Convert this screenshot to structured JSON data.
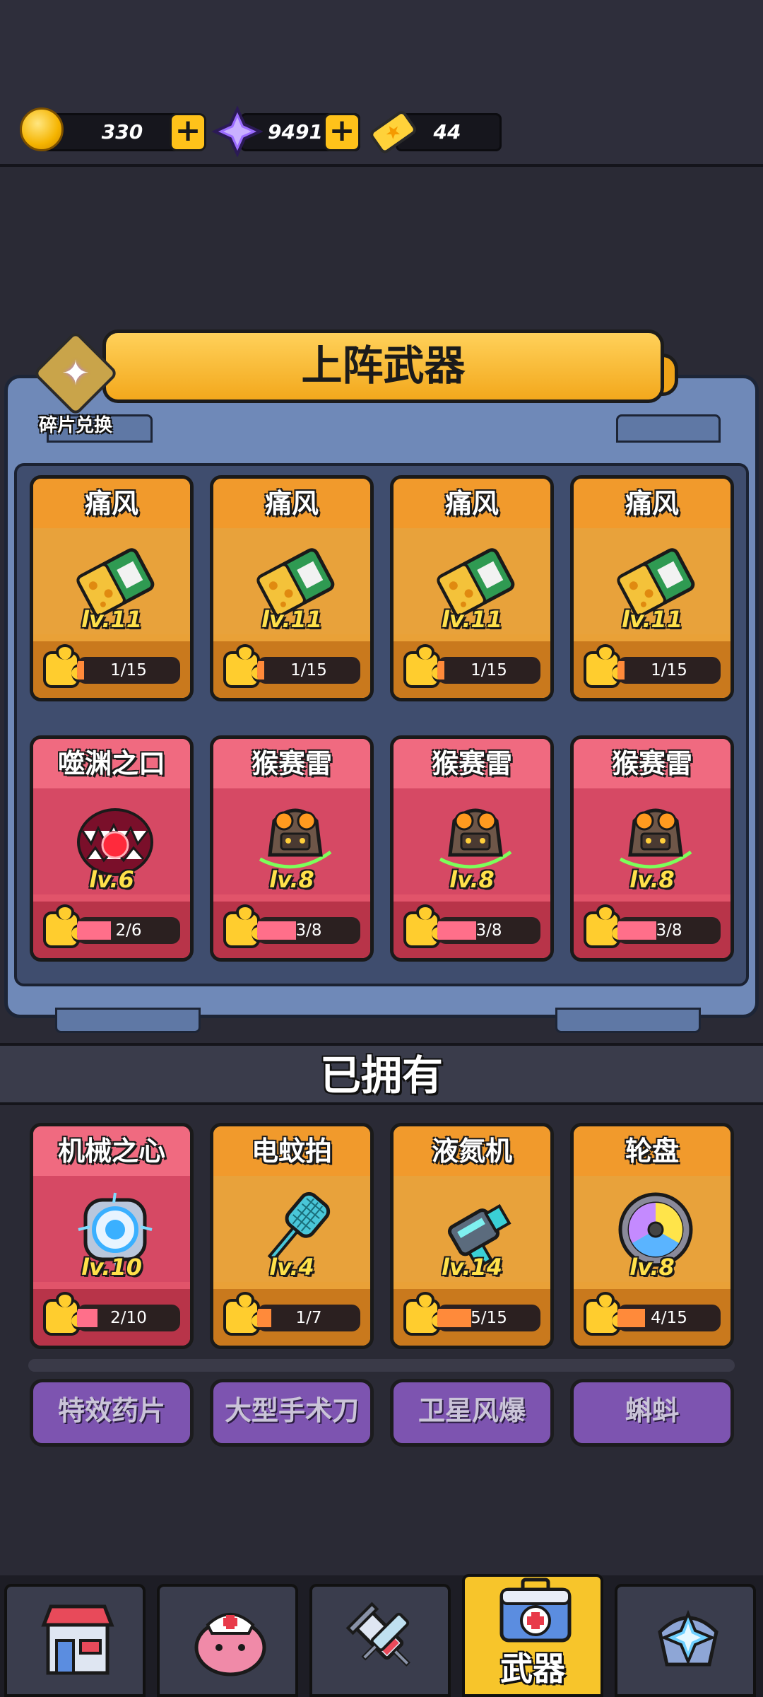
{
  "currencies": {
    "coins": "330",
    "gems": "9491",
    "tickets": "44"
  },
  "deck": {
    "title": "上阵武器",
    "shard_exchange_label": "碎片兑换",
    "cards": [
      {
        "name": "痛风",
        "level": "lv.11",
        "progress": "1/15",
        "fill": 0.0667,
        "theme": "orange",
        "icon": "gout-card-icon"
      },
      {
        "name": "痛风",
        "level": "lv.11",
        "progress": "1/15",
        "fill": 0.0667,
        "theme": "orange",
        "icon": "gout-card-icon"
      },
      {
        "name": "痛风",
        "level": "lv.11",
        "progress": "1/15",
        "fill": 0.0667,
        "theme": "orange",
        "icon": "gout-card-icon"
      },
      {
        "name": "痛风",
        "level": "lv.11",
        "progress": "1/15",
        "fill": 0.0667,
        "theme": "orange",
        "icon": "gout-card-icon"
      },
      {
        "name": "噬渊之口",
        "level": "lv.6",
        "progress": "2/6",
        "fill": 0.333,
        "theme": "red",
        "icon": "abyss-mouth-icon"
      },
      {
        "name": "猴赛雷",
        "level": "lv.8",
        "progress": "3/8",
        "fill": 0.375,
        "theme": "red",
        "icon": "monkey-thunder-icon"
      },
      {
        "name": "猴赛雷",
        "level": "lv.8",
        "progress": "3/8",
        "fill": 0.375,
        "theme": "red",
        "icon": "monkey-thunder-icon"
      },
      {
        "name": "猴赛雷",
        "level": "lv.8",
        "progress": "3/8",
        "fill": 0.375,
        "theme": "red",
        "icon": "monkey-thunder-icon"
      }
    ]
  },
  "owned": {
    "title": "已拥有",
    "cards": [
      {
        "name": "机械之心",
        "level": "lv.10",
        "progress": "2/10",
        "fill": 0.2,
        "theme": "red",
        "icon": "mech-heart-icon"
      },
      {
        "name": "电蚊拍",
        "level": "lv.4",
        "progress": "1/7",
        "fill": 0.143,
        "theme": "orange",
        "icon": "fly-swatter-icon"
      },
      {
        "name": "液氮机",
        "level": "lv.14",
        "progress": "5/15",
        "fill": 0.333,
        "theme": "orange",
        "icon": "liquid-nitrogen-icon"
      },
      {
        "name": "轮盘",
        "level": "lv.8",
        "progress": "4/15",
        "fill": 0.267,
        "theme": "orange",
        "icon": "roulette-icon"
      }
    ],
    "locked": [
      "特效药片",
      "大型手术刀",
      "卫星风爆",
      "蝌蚪"
    ]
  },
  "nav": {
    "tabs": [
      {
        "name": "shop",
        "icon": "shop-icon",
        "label": ""
      },
      {
        "name": "brain",
        "icon": "nurse-brain-icon",
        "label": ""
      },
      {
        "name": "syringe",
        "icon": "syringe-icon",
        "label": ""
      },
      {
        "name": "weapons",
        "icon": "medkit-icon",
        "label": "武器"
      },
      {
        "name": "ranking",
        "icon": "crystal-emblem-icon",
        "label": ""
      }
    ]
  }
}
